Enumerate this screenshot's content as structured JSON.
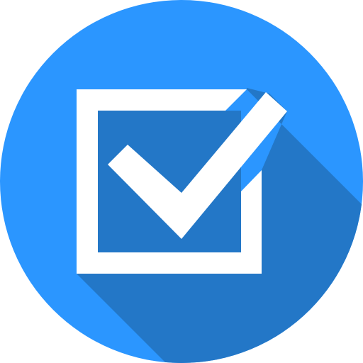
{
  "icon": {
    "name": "checkbox-checked-icon",
    "colors": {
      "background": "#ffffff",
      "circle": "#2b96ff",
      "shadow": "#2377c7",
      "mark": "#ffffff"
    }
  }
}
